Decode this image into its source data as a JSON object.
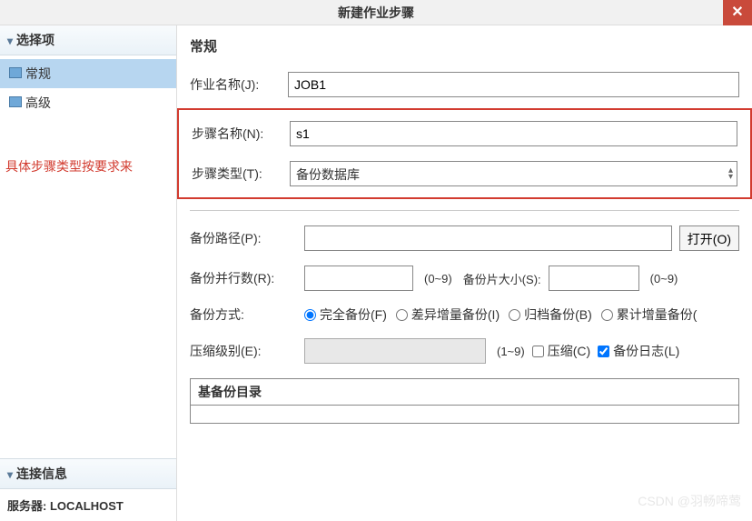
{
  "dialog": {
    "title": "新建作业步骤"
  },
  "sidebar": {
    "options_header": "选择项",
    "items": [
      {
        "label": "常规",
        "active": true
      },
      {
        "label": "高级",
        "active": false
      }
    ],
    "annotation": "具体步骤类型按要求来",
    "connection_header": "连接信息",
    "server_label": "服务器: LOCALHOST"
  },
  "form": {
    "section_title": "常规",
    "job_name_label": "作业名称(J):",
    "job_name_value": "JOB1",
    "step_name_label": "步骤名称(N):",
    "step_name_value": "s1",
    "step_type_label": "步骤类型(T):",
    "step_type_value": "备份数据库",
    "backup_path_label": "备份路径(P):",
    "backup_path_value": "",
    "open_btn": "打开(O)",
    "parallel_label": "备份并行数(R):",
    "parallel_value": "",
    "parallel_hint": "(0~9)",
    "piece_size_label": "备份片大小(S):",
    "piece_size_value": "",
    "piece_size_hint": "(0~9)",
    "backup_mode_label": "备份方式:",
    "modes": {
      "full": "完全备份(F)",
      "diff": "差异增量备份(I)",
      "archive": "归档备份(B)",
      "cumulative": "累计增量备份("
    },
    "compress_level_label": "压缩级别(E):",
    "compress_level_hint": "(1~9)",
    "compress_cb": "压缩(C)",
    "backup_log_cb": "备份日志(L)",
    "base_backup_header": "基备份目录"
  },
  "watermark": "CSDN @羽畅啼莺"
}
